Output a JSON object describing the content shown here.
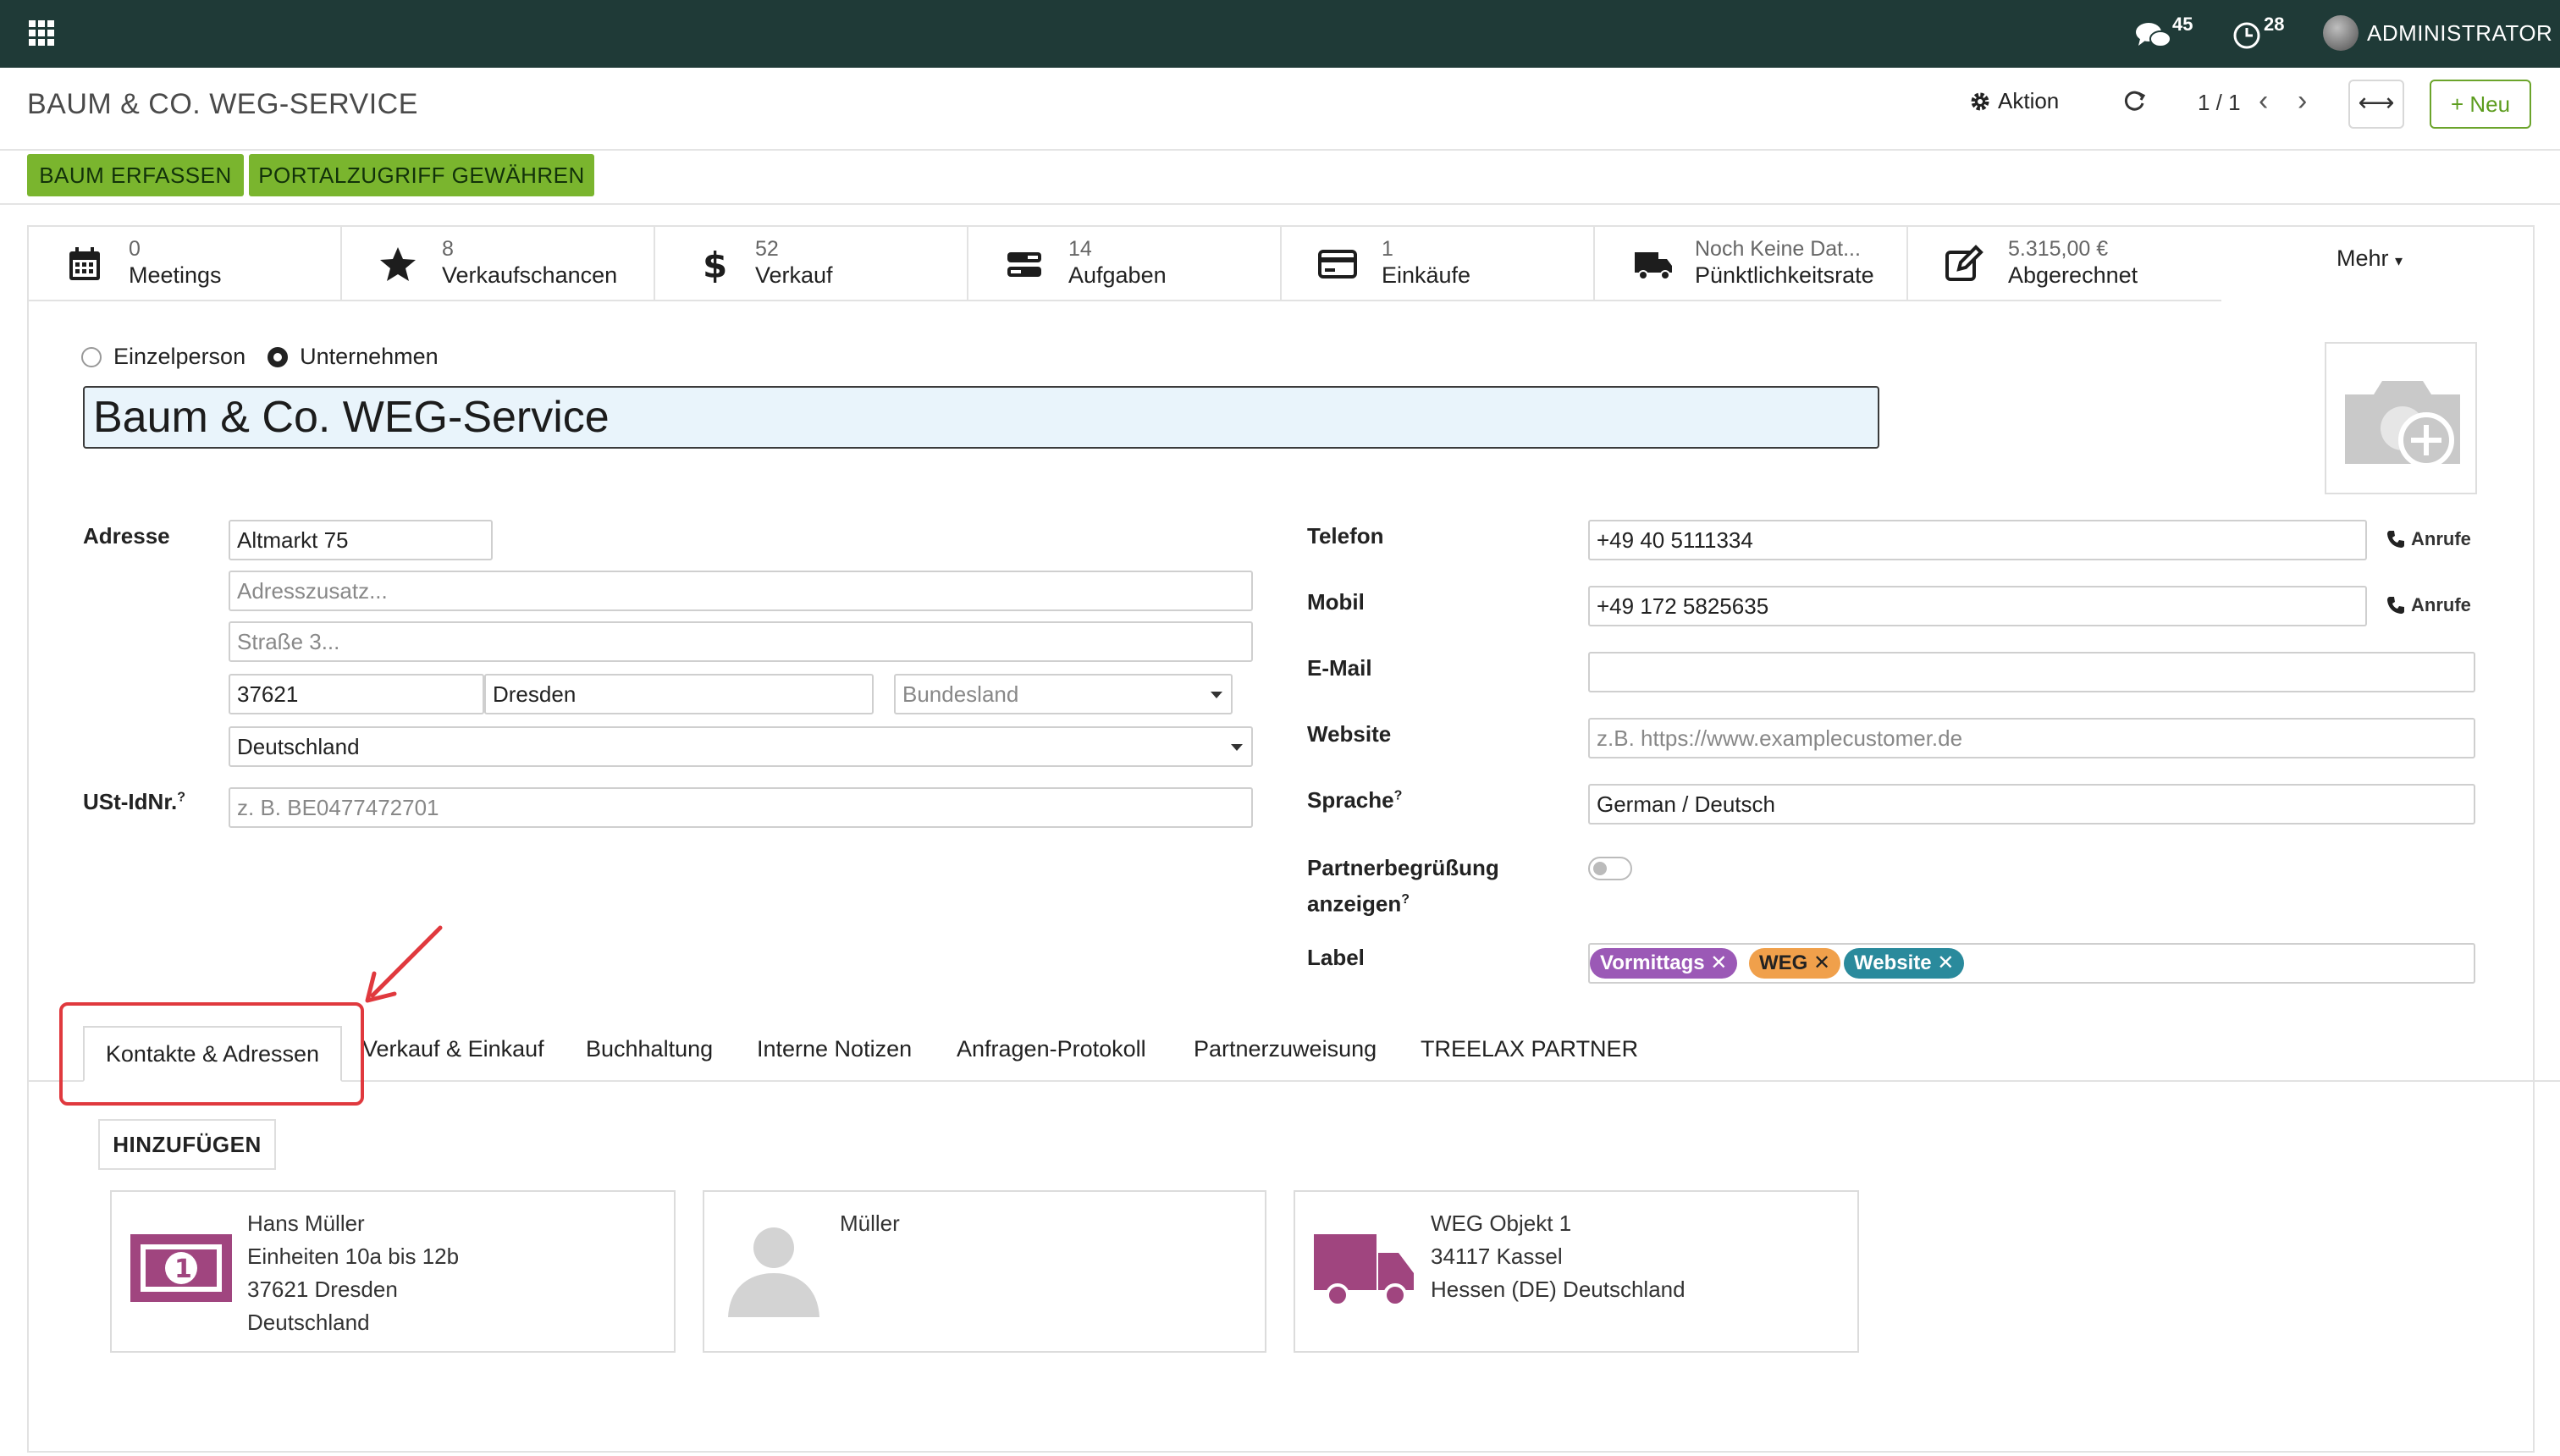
{
  "topbar": {
    "apps_icon": "apps-grid-icon",
    "messages_count": "45",
    "activities_count": "28",
    "user_name": "ADMINISTRATOR"
  },
  "control": {
    "breadcrumb": "BAUM & CO. WEG-SERVICE",
    "action_label": "Aktion",
    "pager": "1 / 1",
    "new_label": "Neu"
  },
  "status_buttons": {
    "tree_capture": "BAUM ERFASSEN",
    "portal_access": "PORTALZUGRIFF GEWÄHREN"
  },
  "smart_buttons": [
    {
      "icon": "calendar-icon",
      "value": "0",
      "label": "Meetings"
    },
    {
      "icon": "star-icon",
      "value": "8",
      "label": "Verkaufschancen"
    },
    {
      "icon": "dollar-icon",
      "value": "52",
      "label": "Verkauf"
    },
    {
      "icon": "tasks-icon",
      "value": "14",
      "label": "Aufgaben"
    },
    {
      "icon": "credit-card-icon",
      "value": "1",
      "label": "Einkäufe"
    },
    {
      "icon": "truck-icon",
      "value": "Noch Keine Dat...",
      "label": "Pünktlichkeitsrate"
    },
    {
      "icon": "edit-icon",
      "value": "5.315,00 €",
      "label": "Abgerechnet"
    }
  ],
  "more_label": "Mehr",
  "company_type": {
    "individual": "Einzelperson",
    "company": "Unternehmen",
    "selected": "Unternehmen"
  },
  "partner_name": "Baum & Co. WEG-Service",
  "address": {
    "label": "Adresse",
    "street": "Altmarkt 75",
    "street2_placeholder": "Adresszusatz...",
    "street3_placeholder": "Straße 3...",
    "zip": "37621",
    "city": "Dresden",
    "state_placeholder": "Bundesland",
    "country": "Deutschland"
  },
  "vat": {
    "label": "USt-IdNr.",
    "help": "?",
    "placeholder": "z. B. BE0477472701"
  },
  "contact": {
    "phone_label": "Telefon",
    "phone": "+49 40 5111334",
    "mobile_label": "Mobil",
    "mobile": "+49 172 5825635",
    "call_label": "Anrufe",
    "email_label": "E-Mail",
    "email": "",
    "website_label": "Website",
    "website_placeholder": "z.B. https://www.examplecustomer.de",
    "language_label": "Sprache",
    "language_help": "?",
    "language": "German / Deutsch",
    "greeting_label_1": "Partnerbegrüßung",
    "greeting_label_2": "anzeigen",
    "greeting_help": "?",
    "tags_label": "Label"
  },
  "tags": [
    {
      "label": "Vormittags",
      "color": "#9b59b6"
    },
    {
      "label": "WEG",
      "color": "#f0a04b"
    },
    {
      "label": "Website",
      "color": "#2a8a9c"
    }
  ],
  "tag_remove": "✕",
  "tabs": {
    "active": "Kontakte & Adressen",
    "others": [
      "Verkauf & Einkauf",
      "Buchhaltung",
      "Interne Notizen",
      "Anfragen-Protokoll",
      "Partnerzuweisung",
      "TREELAX PARTNER"
    ]
  },
  "add_button": "HINZUFÜGEN",
  "contacts": [
    {
      "icon": "money-bill-icon",
      "lines": [
        "Hans Müller",
        "Einheiten 10a bis 12b",
        "37621 Dresden",
        "Deutschland"
      ]
    },
    {
      "icon": "person-placeholder-icon",
      "lines": [
        "Müller"
      ]
    },
    {
      "icon": "truck-icon",
      "lines": [
        "WEG Objekt 1",
        "34117 Kassel",
        "Hessen (DE) Deutschland"
      ]
    }
  ],
  "colors": {
    "topbar": "#1f3a37",
    "primary_green": "#7ab52e",
    "highlight_red": "#e0393e",
    "card_icon_purple": "#a0457f"
  }
}
